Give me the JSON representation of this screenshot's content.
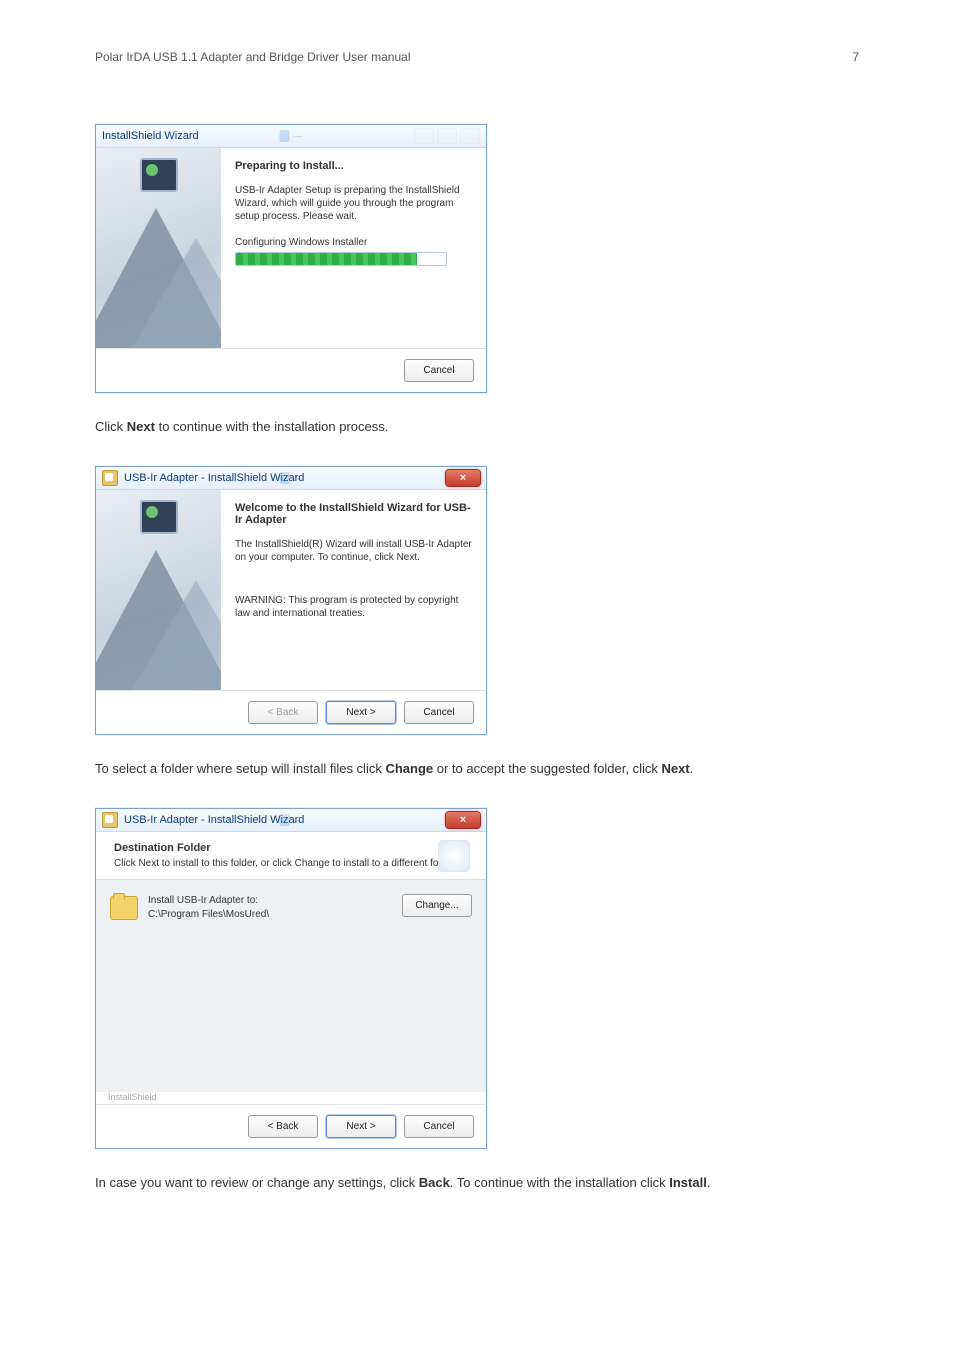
{
  "header": {
    "title": "Polar IrDA USB 1.1 Adapter and Bridge Driver User manual",
    "page_number": "7"
  },
  "dialog1": {
    "title": "InstallShield Wizard",
    "heading": "Preparing to Install...",
    "body": "USB-Ir Adapter Setup is preparing the InstallShield Wizard, which will guide you through the program setup process. Please wait.",
    "progress_label": "Configuring Windows Installer",
    "cancel": "Cancel"
  },
  "para1_pre": "Click ",
  "para1_bold": "Next",
  "para1_post": " to continue with the installation process.",
  "dialog2": {
    "title": "USB-Ir Adapter - InstallShield Wizard",
    "heading": "Welcome to the InstallShield Wizard for USB-Ir Adapter",
    "body1": "The InstallShield(R) Wizard will install USB-Ir Adapter on your computer. To continue, click Next.",
    "body2": "WARNING: This program is protected by copyright law and international treaties.",
    "back": "< Back",
    "next": "Next >",
    "cancel": "Cancel"
  },
  "para2_pre": "To select a folder where setup will install files click ",
  "para2_bold1": "Change",
  "para2_mid": " or to accept the suggested folder, click ",
  "para2_bold2": "Next",
  "para2_post": ".",
  "dialog3": {
    "title": "USB-Ir Adapter - InstallShield Wizard",
    "head": "Destination Folder",
    "sub": "Click Next to install to this folder, or click Change to install to a different folder.",
    "install_to": "Install USB-Ir Adapter to:",
    "path": "C:\\Program Files\\MosUred\\",
    "change": "Change...",
    "tag": "InstallShield",
    "back": "< Back",
    "next": "Next >",
    "cancel": "Cancel"
  },
  "para3_pre": "In case you want to review or change any settings, click ",
  "para3_bold1": "Back",
  "para3_mid": ". To continue with the installation click ",
  "para3_bold2": "Install",
  "para3_post": "."
}
